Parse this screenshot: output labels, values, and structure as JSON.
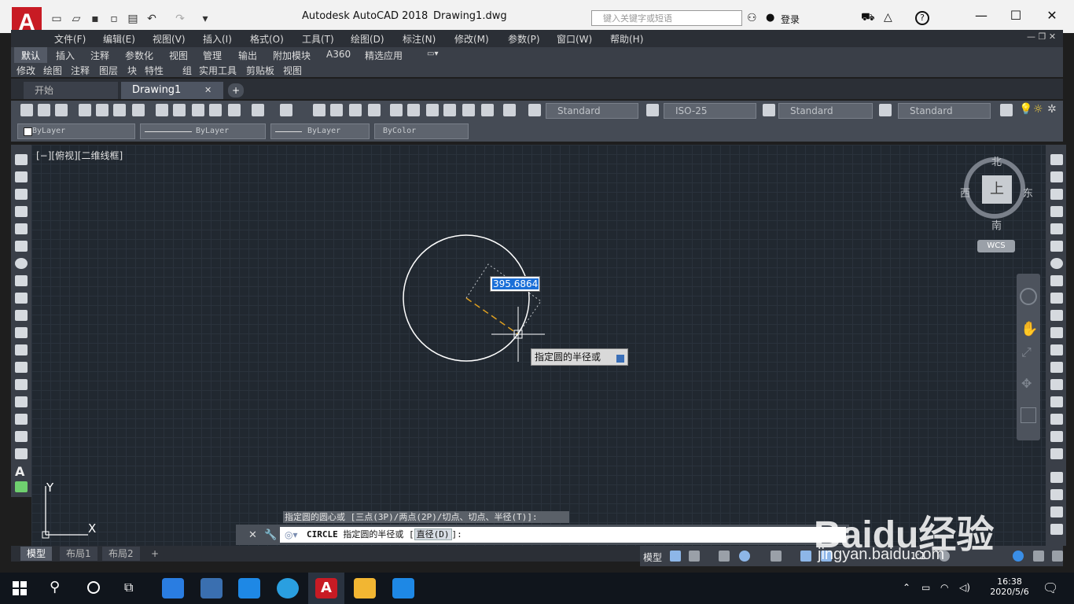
{
  "titlebar": {
    "app_title": "Autodesk AutoCAD 2018",
    "doc_title": "Drawing1.dwg",
    "search_placeholder": "键入关键字或短语",
    "login": "登录",
    "logo": "A"
  },
  "menu": [
    "文件(F)",
    "编辑(E)",
    "视图(V)",
    "插入(I)",
    "格式(O)",
    "工具(T)",
    "绘图(D)",
    "标注(N)",
    "修改(M)",
    "参数(P)",
    "窗口(W)",
    "帮助(H)"
  ],
  "ribbon_tabs": [
    "默认",
    "插入",
    "注释",
    "参数化",
    "视图",
    "管理",
    "输出",
    "附加模块",
    "A360",
    "精选应用"
  ],
  "panels": [
    "修改",
    "绘图",
    "注释",
    "图层",
    "块",
    "特性",
    "组",
    "实用工具",
    "剪贴板",
    "视图"
  ],
  "file_tabs": {
    "start": "开始",
    "drawing": "Drawing1",
    "add": "+"
  },
  "styles": {
    "text": "Standard",
    "dim": "ISO-25",
    "table": "Standard",
    "mleader": "Standard"
  },
  "properties": {
    "layer": "ByLayer",
    "linetype": "ByLayer",
    "lineweight": "ByLayer",
    "color": "ByColor"
  },
  "viewport": {
    "label": "[−][俯视][二维线框]"
  },
  "viewcube": {
    "north": "北",
    "south": "南",
    "east": "东",
    "west": "西",
    "face": "上",
    "wcs": "WCS"
  },
  "drawing": {
    "radius_input": "395.6864",
    "tooltip": "指定圆的半径或"
  },
  "ucs": {
    "x": "X",
    "y": "Y"
  },
  "command": {
    "history": "指定圆的圆心或 [三点(3P)/两点(2P)/切点、切点、半径(T)]:",
    "cmd": "CIRCLE",
    "prompt": "指定圆的半径或",
    "option": "直径(D)",
    "suffix": "]:"
  },
  "layout_tabs": [
    "模型",
    "布局1",
    "布局2",
    "+"
  ],
  "status": {
    "model": "模型",
    "scale": "1:1"
  },
  "taskbar": {
    "time": "16:38",
    "date": "2020/5/6"
  },
  "watermark": {
    "brand": "Baidu经验",
    "url": "jingyan.baidu.com"
  },
  "colors": {
    "canvas": "#212830",
    "circle": "#ffffff",
    "radius_line": "#e0a020",
    "accent": "#c81b24",
    "highlight": "#1a6fd8"
  }
}
